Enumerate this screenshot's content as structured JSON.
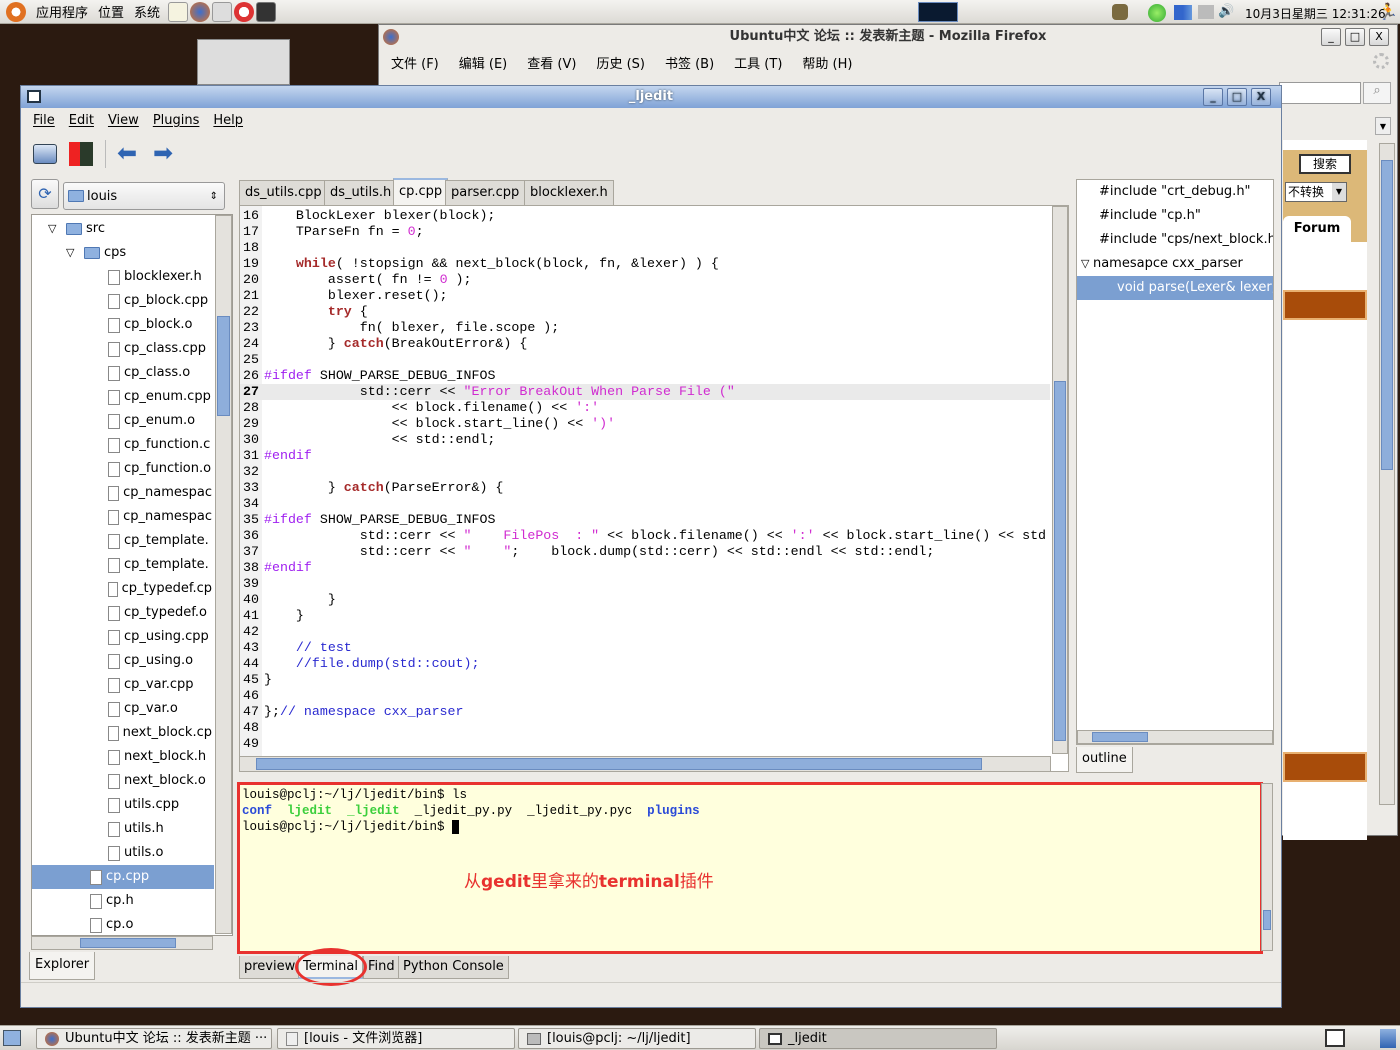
{
  "top_panel": {
    "menus": [
      "应用程序",
      "位置",
      "系统"
    ],
    "clock": "10月3日星期三 12:31:26"
  },
  "firefox": {
    "title": "Ubuntu中文 论坛 :: 发表新主题 -  Mozilla Firefox",
    "menus": [
      "文件 (F)",
      "编辑 (E)",
      "查看 (V)",
      "历史 (S)",
      "书签 (B)",
      "工具 (T)",
      "帮助 (H)"
    ],
    "search_button": "搜索",
    "convert_select": "不转换",
    "forum_tab": "Forum"
  },
  "ljedit": {
    "title": "_ljedit",
    "menus": [
      "File",
      "Edit",
      "View",
      "Plugins",
      "Help"
    ],
    "explorer": {
      "location": "louis",
      "tab": "Explorer",
      "tree": [
        {
          "label": "src",
          "type": "folder",
          "level": 0,
          "expanded": true
        },
        {
          "label": "cps",
          "type": "folder",
          "level": 1,
          "expanded": true
        },
        {
          "label": "blocklexer.h",
          "type": "file",
          "level": 2
        },
        {
          "label": "cp_block.cpp",
          "type": "file",
          "level": 2
        },
        {
          "label": "cp_block.o",
          "type": "file",
          "level": 2
        },
        {
          "label": "cp_class.cpp",
          "type": "file",
          "level": 2
        },
        {
          "label": "cp_class.o",
          "type": "file",
          "level": 2
        },
        {
          "label": "cp_enum.cpp",
          "type": "file",
          "level": 2
        },
        {
          "label": "cp_enum.o",
          "type": "file",
          "level": 2
        },
        {
          "label": "cp_function.c",
          "type": "file",
          "level": 2
        },
        {
          "label": "cp_function.o",
          "type": "file",
          "level": 2
        },
        {
          "label": "cp_namespac",
          "type": "file",
          "level": 2
        },
        {
          "label": "cp_namespac",
          "type": "file",
          "level": 2
        },
        {
          "label": "cp_template.",
          "type": "file",
          "level": 2
        },
        {
          "label": "cp_template.",
          "type": "file",
          "level": 2
        },
        {
          "label": "cp_typedef.cp",
          "type": "file",
          "level": 2
        },
        {
          "label": "cp_typedef.o",
          "type": "file",
          "level": 2
        },
        {
          "label": "cp_using.cpp",
          "type": "file",
          "level": 2
        },
        {
          "label": "cp_using.o",
          "type": "file",
          "level": 2
        },
        {
          "label": "cp_var.cpp",
          "type": "file",
          "level": 2
        },
        {
          "label": "cp_var.o",
          "type": "file",
          "level": 2
        },
        {
          "label": "next_block.cp",
          "type": "file",
          "level": 2
        },
        {
          "label": "next_block.h",
          "type": "file",
          "level": 2
        },
        {
          "label": "next_block.o",
          "type": "file",
          "level": 2
        },
        {
          "label": "utils.cpp",
          "type": "file",
          "level": 2
        },
        {
          "label": "utils.h",
          "type": "file",
          "level": 2
        },
        {
          "label": "utils.o",
          "type": "file",
          "level": 2
        },
        {
          "label": "cp.cpp",
          "type": "file",
          "level": 1,
          "selected": true
        },
        {
          "label": "cp.h",
          "type": "file",
          "level": 1
        },
        {
          "label": "cp.o",
          "type": "file",
          "level": 1
        }
      ]
    },
    "tabs": [
      {
        "label": "ds_utils.cpp"
      },
      {
        "label": "ds_utils.h"
      },
      {
        "label": "cp.cpp",
        "active": true
      },
      {
        "label": "parser.cpp"
      },
      {
        "label": "blocklexer.h"
      }
    ],
    "code": {
      "first_line": 16,
      "current_line": 27,
      "lines": [
        [
          [
            "    BlockLexer blexer(block);",
            ""
          ]
        ],
        [
          [
            "    TParseFn fn = ",
            ""
          ],
          [
            "0",
            "num"
          ],
          [
            ";",
            ""
          ]
        ],
        [],
        [
          [
            "    ",
            ""
          ],
          [
            "while",
            "kw"
          ],
          [
            "( !stopsign && next_block(block, fn, &lexer) ) {",
            ""
          ]
        ],
        [
          [
            "        assert( fn != ",
            ""
          ],
          [
            "0",
            "num"
          ],
          [
            " );",
            ""
          ]
        ],
        [
          [
            "        blexer.reset();",
            ""
          ]
        ],
        [
          [
            "        ",
            ""
          ],
          [
            "try",
            "kw"
          ],
          [
            " {",
            ""
          ]
        ],
        [
          [
            "            fn( blexer, file.scope );",
            ""
          ]
        ],
        [
          [
            "        } ",
            ""
          ],
          [
            "catch",
            "kw"
          ],
          [
            "(BreakOutError&) {",
            ""
          ]
        ],
        [],
        [
          [
            "#ifdef",
            "pp"
          ],
          [
            " SHOW_PARSE_DEBUG_INFOS",
            ""
          ]
        ],
        [
          [
            "            std::cerr << ",
            ""
          ],
          [
            "\"Error BreakOut When Parse File (\"",
            "str"
          ]
        ],
        [
          [
            "                << block.filename() << ",
            ""
          ],
          [
            "':'",
            "str"
          ]
        ],
        [
          [
            "                << block.start_line() << ",
            ""
          ],
          [
            "')'",
            "str"
          ]
        ],
        [
          [
            "                << std::endl;",
            ""
          ]
        ],
        [
          [
            "#endif",
            "pp"
          ]
        ],
        [],
        [
          [
            "        } ",
            ""
          ],
          [
            "catch",
            "kw"
          ],
          [
            "(ParseError&) {",
            ""
          ]
        ],
        [],
        [
          [
            "#ifdef",
            "pp"
          ],
          [
            " SHOW_PARSE_DEBUG_INFOS",
            ""
          ]
        ],
        [
          [
            "            std::cerr << ",
            ""
          ],
          [
            "\"    FilePos  : \"",
            "str"
          ],
          [
            " << block.filename() << ",
            ""
          ],
          [
            "':'",
            "str"
          ],
          [
            " << block.start_line() << std",
            ""
          ]
        ],
        [
          [
            "            std::cerr << ",
            ""
          ],
          [
            "\"    \"",
            "str"
          ],
          [
            ";    block.dump(std::cerr) << std::endl << std::endl;",
            ""
          ]
        ],
        [
          [
            "#endif",
            "pp"
          ]
        ],
        [],
        [
          [
            "        }",
            ""
          ]
        ],
        [
          [
            "    }",
            ""
          ]
        ],
        [],
        [
          [
            "    ",
            ""
          ],
          [
            "// test",
            "cm"
          ]
        ],
        [
          [
            "    ",
            ""
          ],
          [
            "//file.dump(std::cout);",
            "cm"
          ]
        ],
        [
          [
            "}",
            ""
          ]
        ],
        [],
        [
          [
            "};",
            ""
          ],
          [
            "// namespace cxx_parser",
            "cm"
          ]
        ],
        [],
        []
      ]
    },
    "outline": {
      "tab": "outline",
      "items": [
        {
          "label": "#include \"crt_debug.h\"",
          "level": 0
        },
        {
          "label": "#include \"cp.h\"",
          "level": 0
        },
        {
          "label": "#include \"cps/next_block.h\"",
          "level": 0
        },
        {
          "label": "namesapce cxx_parser",
          "level": 0,
          "expanded": true
        },
        {
          "label": "void parse(Lexer& lexer,",
          "level": 1,
          "selected": true
        }
      ]
    },
    "terminal": {
      "lines": [
        [
          [
            "louis@pclj:~/lj/ljedit/bin$ ls",
            "#000000"
          ]
        ],
        [
          [
            "conf",
            "#2a4ad8"
          ],
          [
            "  ",
            "#000"
          ],
          [
            "ljedit",
            "#3ccf3c"
          ],
          [
            "  ",
            "#000"
          ],
          [
            "_ljedit",
            "#3ccf3c"
          ],
          [
            "  _ljedit_py.py  _ljedit_py.pyc  ",
            "#000000"
          ],
          [
            "plugins",
            "#2a4ad8"
          ]
        ],
        [
          [
            "louis@pclj:~/lj/ljedit/bin$ ",
            "#000000"
          ]
        ]
      ],
      "annotation": [
        "从",
        "gedit",
        "里拿来的",
        "terminal",
        "插件"
      ]
    },
    "bottom_tabs": [
      {
        "label": "preview"
      },
      {
        "label": "Terminal",
        "active": true
      },
      {
        "label": "Find"
      },
      {
        "label": "Python Console"
      }
    ]
  },
  "taskbar": {
    "tasks": [
      {
        "label": "Ubuntu中文 论坛 :: 发表新主题 ···"
      },
      {
        "label": "[louis - 文件浏览器]"
      },
      {
        "label": "[louis@pclj: ~/lj/ljedit]"
      },
      {
        "label": "_ljedit",
        "active": true
      }
    ]
  },
  "colors": {
    "selection": "#7b9fd1",
    "annotation_red": "#e8322f",
    "terminal_bg": "#ffffdd",
    "titlebar": "#7fa2d6"
  }
}
